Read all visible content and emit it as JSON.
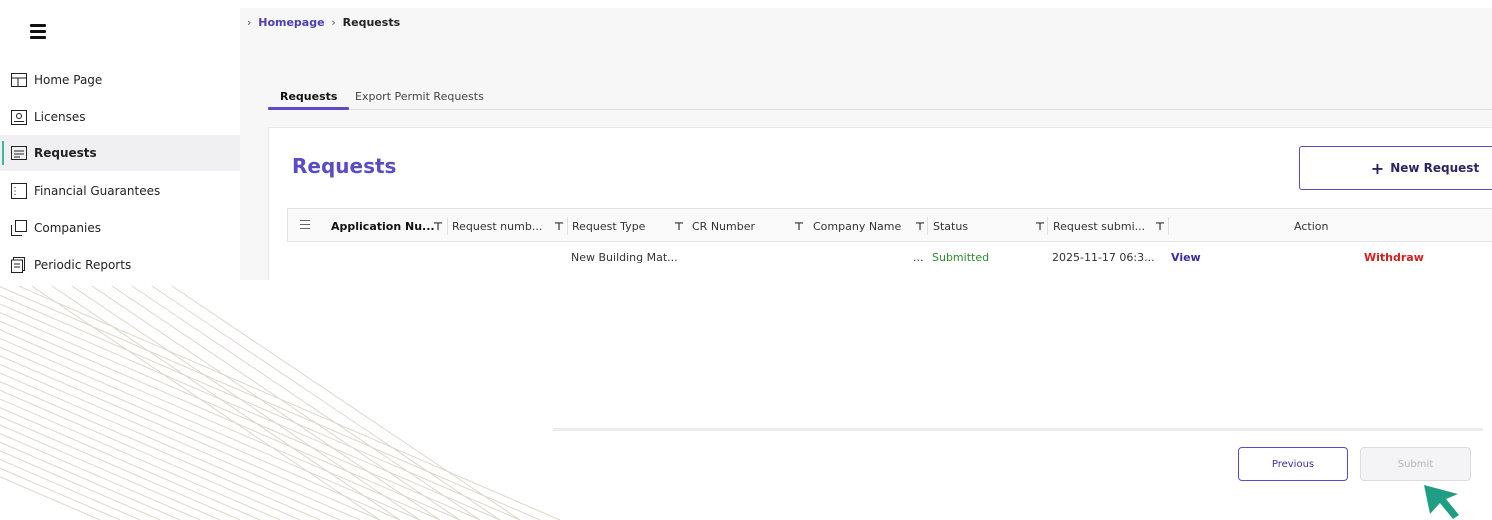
{
  "sidebar": {
    "items": [
      {
        "label": "Home Page",
        "icon": "layout-icon"
      },
      {
        "label": "Licenses",
        "icon": "license-icon"
      },
      {
        "label": "Requests",
        "icon": "requests-icon",
        "active": true
      },
      {
        "label": "Financial Guarantees",
        "icon": "guarantee-icon"
      },
      {
        "label": "Companies",
        "icon": "companies-icon"
      },
      {
        "label": "Periodic Reports",
        "icon": "reports-icon"
      }
    ]
  },
  "breadcrumb": {
    "home": "Homepage",
    "current": "Requests"
  },
  "tabs": [
    "Requests",
    "Export Permit Requests"
  ],
  "card": {
    "title": "Requests",
    "new_button": "New Request"
  },
  "table": {
    "headers": [
      "Application Nu...",
      "Request numb...",
      "Request Type",
      "CR Number",
      "Company Name",
      "Status",
      "Request submi...",
      "Action"
    ],
    "rows": [
      {
        "application_number": "",
        "request_number": "",
        "request_type": "New Building Mat...",
        "cr_number": "",
        "company_name": "...",
        "status": "Submitted",
        "submitted": "2025-11-17 06:3...",
        "view": "View",
        "withdraw": "Withdraw"
      }
    ]
  },
  "footer": {
    "previous": "Previous",
    "submit": "Submit"
  },
  "colors": {
    "accent": "#5b4bc4",
    "active_marker": "#3bb89a",
    "status_green": "#2e8b2e",
    "withdraw_red": "#d42020",
    "cursor": "#1f9e83"
  }
}
